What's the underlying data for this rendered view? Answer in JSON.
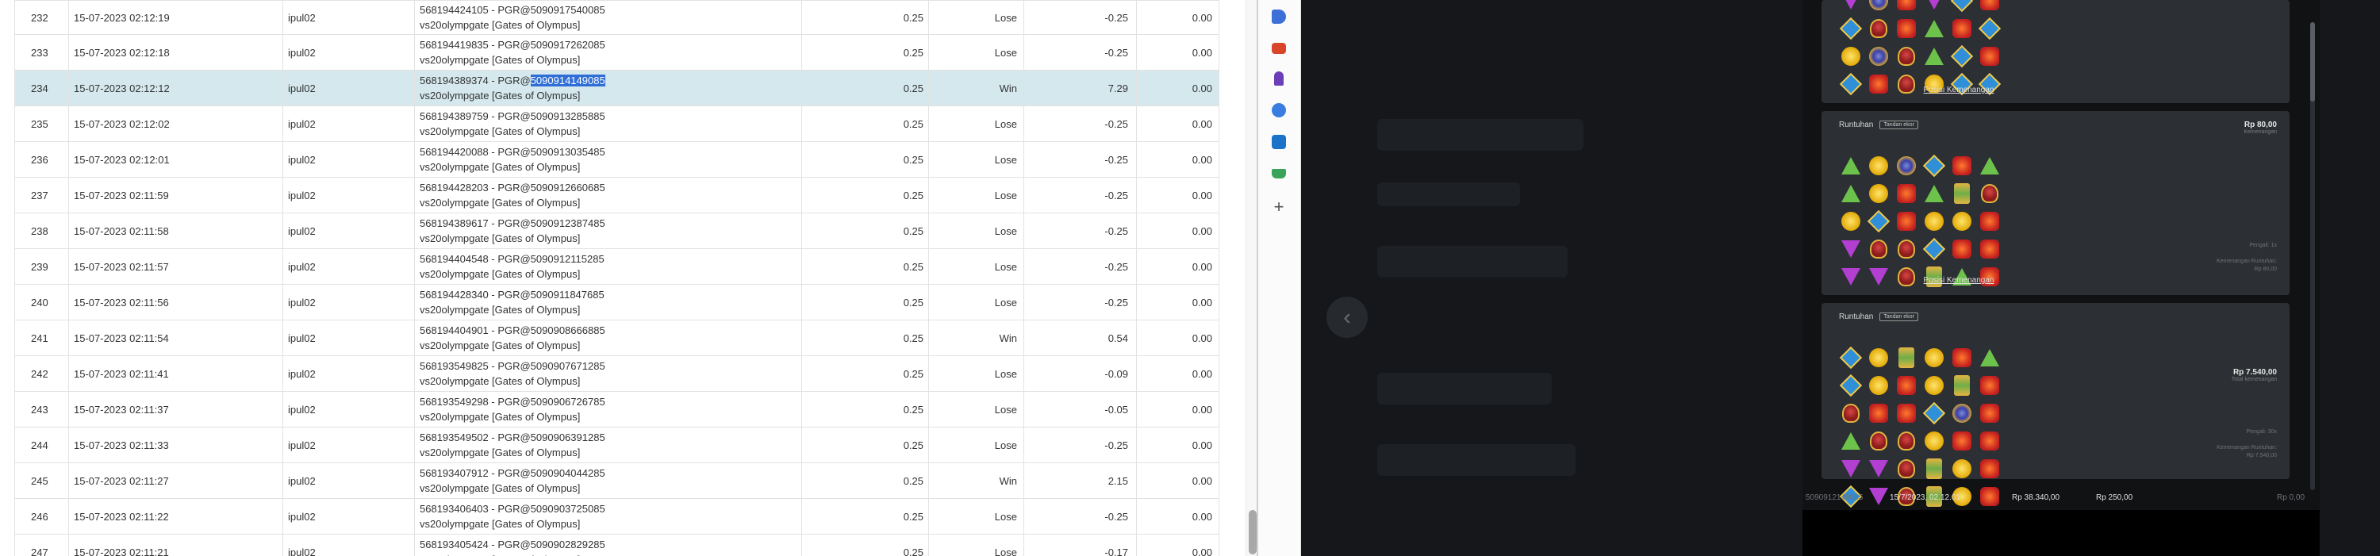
{
  "table": {
    "rows": [
      {
        "no": "232",
        "time": "15-07-2023 02:12:19",
        "user": "ipul02",
        "ref_pre": "568194424105 - PGR@5090917540085",
        "ref_hl": "",
        "ref_post": "",
        "game": "vs20olympgate [Gates of Olympus]",
        "bet": "0.25",
        "result": "Lose",
        "amount": "-0.25",
        "balance": "0.00"
      },
      {
        "no": "233",
        "time": "15-07-2023 02:12:18",
        "user": "ipul02",
        "ref_pre": "568194419835 - PGR@5090917262085",
        "ref_hl": "",
        "ref_post": "",
        "game": "vs20olympgate [Gates of Olympus]",
        "bet": "0.25",
        "result": "Lose",
        "amount": "-0.25",
        "balance": "0.00"
      },
      {
        "no": "234",
        "time": "15-07-2023 02:12:12",
        "user": "ipul02",
        "ref_pre": "568194389374 - PGR@",
        "ref_hl": "5090914149085",
        "ref_post": "",
        "game": "vs20olympgate [Gates of Olympus]",
        "bet": "0.25",
        "result": "Win",
        "amount": "7.29",
        "balance": "0.00",
        "selected": true
      },
      {
        "no": "235",
        "time": "15-07-2023 02:12:02",
        "user": "ipul02",
        "ref_pre": "568194389759 - PGR@5090913285885",
        "ref_hl": "",
        "ref_post": "",
        "game": "vs20olympgate [Gates of Olympus]",
        "bet": "0.25",
        "result": "Lose",
        "amount": "-0.25",
        "balance": "0.00"
      },
      {
        "no": "236",
        "time": "15-07-2023 02:12:01",
        "user": "ipul02",
        "ref_pre": "568194420088 - PGR@5090913035485",
        "ref_hl": "",
        "ref_post": "",
        "game": "vs20olympgate [Gates of Olympus]",
        "bet": "0.25",
        "result": "Lose",
        "amount": "-0.25",
        "balance": "0.00"
      },
      {
        "no": "237",
        "time": "15-07-2023 02:11:59",
        "user": "ipul02",
        "ref_pre": "568194428203 - PGR@5090912660685",
        "ref_hl": "",
        "ref_post": "",
        "game": "vs20olympgate [Gates of Olympus]",
        "bet": "0.25",
        "result": "Lose",
        "amount": "-0.25",
        "balance": "0.00"
      },
      {
        "no": "238",
        "time": "15-07-2023 02:11:58",
        "user": "ipul02",
        "ref_pre": "568194389617 - PGR@5090912387485",
        "ref_hl": "",
        "ref_post": "",
        "game": "vs20olympgate [Gates of Olympus]",
        "bet": "0.25",
        "result": "Lose",
        "amount": "-0.25",
        "balance": "0.00"
      },
      {
        "no": "239",
        "time": "15-07-2023 02:11:57",
        "user": "ipul02",
        "ref_pre": "568194404548 - PGR@5090912115285",
        "ref_hl": "",
        "ref_post": "",
        "game": "vs20olympgate [Gates of Olympus]",
        "bet": "0.25",
        "result": "Lose",
        "amount": "-0.25",
        "balance": "0.00"
      },
      {
        "no": "240",
        "time": "15-07-2023 02:11:56",
        "user": "ipul02",
        "ref_pre": "568194428340 - PGR@5090911847685",
        "ref_hl": "",
        "ref_post": "",
        "game": "vs20olympgate [Gates of Olympus]",
        "bet": "0.25",
        "result": "Lose",
        "amount": "-0.25",
        "balance": "0.00"
      },
      {
        "no": "241",
        "time": "15-07-2023 02:11:54",
        "user": "ipul02",
        "ref_pre": "568194404901 - PGR@5090908666885",
        "ref_hl": "",
        "ref_post": "",
        "game": "vs20olympgate [Gates of Olympus]",
        "bet": "0.25",
        "result": "Win",
        "amount": "0.54",
        "balance": "0.00"
      },
      {
        "no": "242",
        "time": "15-07-2023 02:11:41",
        "user": "ipul02",
        "ref_pre": "568193549825 - PGR@5090907671285",
        "ref_hl": "",
        "ref_post": "",
        "game": "vs20olympgate [Gates of Olympus]",
        "bet": "0.25",
        "result": "Lose",
        "amount": "-0.09",
        "balance": "0.00"
      },
      {
        "no": "243",
        "time": "15-07-2023 02:11:37",
        "user": "ipul02",
        "ref_pre": "568193549298 - PGR@5090906726785",
        "ref_hl": "",
        "ref_post": "",
        "game": "vs20olympgate [Gates of Olympus]",
        "bet": "0.25",
        "result": "Lose",
        "amount": "-0.05",
        "balance": "0.00"
      },
      {
        "no": "244",
        "time": "15-07-2023 02:11:33",
        "user": "ipul02",
        "ref_pre": "568193549502 - PGR@5090906391285",
        "ref_hl": "",
        "ref_post": "",
        "game": "vs20olympgate [Gates of Olympus]",
        "bet": "0.25",
        "result": "Lose",
        "amount": "-0.25",
        "balance": "0.00"
      },
      {
        "no": "245",
        "time": "15-07-2023 02:11:27",
        "user": "ipul02",
        "ref_pre": "568193407912 - PGR@5090904044285",
        "ref_hl": "",
        "ref_post": "",
        "game": "vs20olympgate [Gates of Olympus]",
        "bet": "0.25",
        "result": "Win",
        "amount": "2.15",
        "balance": "0.00"
      },
      {
        "no": "246",
        "time": "15-07-2023 02:11:22",
        "user": "ipul02",
        "ref_pre": "568193406403 - PGR@5090903725085",
        "ref_hl": "",
        "ref_post": "",
        "game": "vs20olympgate [Gates of Olympus]",
        "bet": "0.25",
        "result": "Lose",
        "amount": "-0.25",
        "balance": "0.00"
      },
      {
        "no": "247",
        "time": "15-07-2023 02:11:21",
        "user": "ipul02",
        "ref_pre": "568193405424 - PGR@5090902829285",
        "ref_hl": "",
        "ref_post": "",
        "game": "vs20olympgate [Gates of Olympus]",
        "bet": "0.25",
        "result": "Lose",
        "amount": "-0.17",
        "balance": "0.00"
      }
    ]
  },
  "sidebar_icons": [
    {
      "name": "tag-icon",
      "color": "#3c6fd8"
    },
    {
      "name": "toolbox-icon",
      "color": "#d9452b"
    },
    {
      "name": "chess-icon",
      "color": "#6a3fb8"
    },
    {
      "name": "hexagon-icon",
      "color": "#3a7de0"
    },
    {
      "name": "outlook-icon",
      "color": "#1a73c9"
    },
    {
      "name": "cart-icon",
      "color": "#3aa35a"
    },
    {
      "name": "plus-icon",
      "color": "#555555"
    }
  ],
  "sidebar_plus": "+",
  "overlay": {
    "prev_arrow": "‹"
  },
  "history": {
    "card1": {
      "link": "Posisi Kemenangan"
    },
    "card2": {
      "title": "Runtuhan",
      "tag": "Tandan ekor",
      "win_value": "Rp 80,00",
      "win_label": "Kemenangan",
      "meta1": "Pengali: 1x",
      "meta2": "Kemenangan Runtuhan:",
      "meta3": "Rp 80,00",
      "link": "Posisi Kemenangan"
    },
    "card3": {
      "title": "Runtuhan",
      "tag": "Tandan ekor",
      "win_value": "Rp 7.540,00",
      "win_label": "Total kemenangan",
      "meta1": "Pengali: 30x",
      "meta2": "Kemenangan Runtuhan:",
      "meta3": "Rp 7.540,00"
    },
    "footer": {
      "id": "5090912149085",
      "datetime": "15/7/2023, 02.12.01",
      "balance": "Rp 38.340,00",
      "bet": "Rp 250,00",
      "win": "Rp 0,00"
    }
  },
  "colors": {
    "selected_row": "#d4e8ee",
    "lose": "#e53935",
    "win": "#2e7d32",
    "panel_bg": "#2c2f33"
  }
}
